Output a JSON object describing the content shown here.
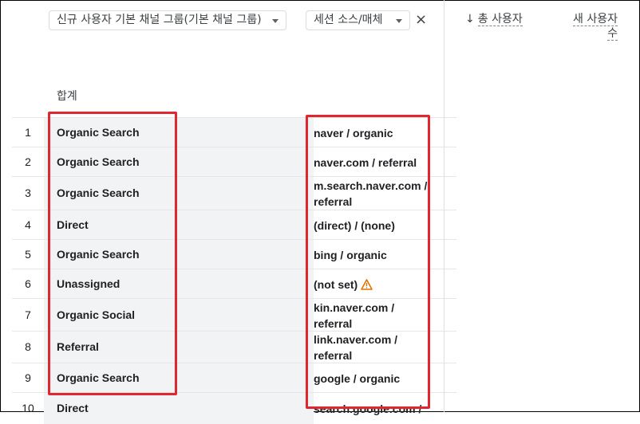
{
  "filters": {
    "primary_dimension": "신규 사용자 기본 채널 그룹(기본 채널 그룹)",
    "secondary_dimension": "세션 소스/매체",
    "close_icon": "×"
  },
  "metrics": {
    "total_users": "총 사용자",
    "new_users_line1": "새 사용자",
    "new_users_line2": "수",
    "sort_icon": "↓"
  },
  "totals_label": "합계",
  "rows": [
    {
      "num": "1",
      "channel": "Organic Search",
      "source": [
        "naver / organic"
      ]
    },
    {
      "num": "2",
      "channel": "Organic Search",
      "source": [
        "naver.com / referral"
      ]
    },
    {
      "num": "3",
      "channel": "Organic Search",
      "source": [
        "m.search.naver.com /",
        "referral"
      ]
    },
    {
      "num": "4",
      "channel": "Direct",
      "source": [
        "(direct) / (none)"
      ]
    },
    {
      "num": "5",
      "channel": "Organic Search",
      "source": [
        "bing / organic"
      ]
    },
    {
      "num": "6",
      "channel": "Unassigned",
      "source": [
        "(not set)"
      ],
      "warning": true
    },
    {
      "num": "7",
      "channel": "Organic Social",
      "source": [
        "kin.naver.com /",
        "referral"
      ]
    },
    {
      "num": "8",
      "channel": "Referral",
      "source": [
        "link.naver.com /",
        "referral"
      ]
    },
    {
      "num": "9",
      "channel": "Organic Search",
      "source": [
        "google / organic"
      ]
    },
    {
      "num": "10",
      "channel": "Direct",
      "source": [
        "search.google.com /"
      ]
    }
  ],
  "colors": {
    "highlight": "#e0262f",
    "warning": "#e37400"
  }
}
